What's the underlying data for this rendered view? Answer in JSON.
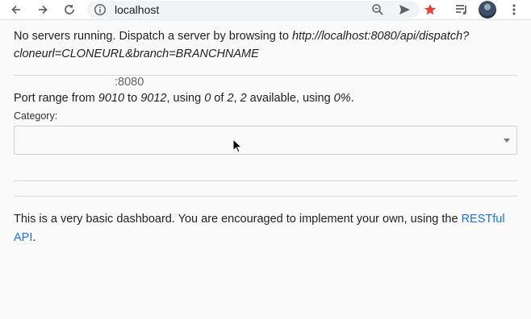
{
  "browser": {
    "url_host": "localhost",
    "url_port": ":8080"
  },
  "message": {
    "prefix": "No servers running. Dispatch a server by browsing to ",
    "dispatch_url": "http://localhost:8080/api/dispatch?cloneurl=CLONEURL&branch=BRANCHNAME"
  },
  "port_range": {
    "t1": "Port range from ",
    "from": "9010",
    "t2": " to ",
    "to": "9012",
    "t3": ", using ",
    "used": "0",
    "t4": " of ",
    "total": "2",
    "t5": ", ",
    "available": "2",
    "t6": " available, using ",
    "percent": "0%",
    "t7": "."
  },
  "category": {
    "label": "Category:",
    "selected": ""
  },
  "footer": {
    "text": "This is a very basic dashboard. You are encouraged to implement your own, using the ",
    "link": "RESTful API",
    "end": "."
  },
  "icons": [
    "back-icon",
    "forward-icon",
    "reload-icon",
    "info-icon",
    "zoom-out-icon",
    "send-icon",
    "star-icon",
    "reading-list-icon",
    "avatar",
    "more-icon"
  ],
  "colors": {
    "star": "#e8453c",
    "link": "#1a73e8"
  }
}
